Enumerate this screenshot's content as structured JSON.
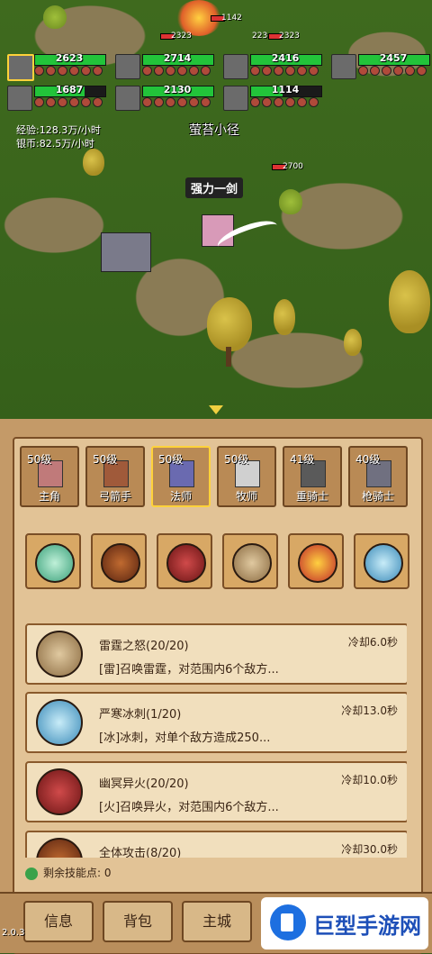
{
  "party": [
    {
      "hp": "2623",
      "selected": true
    },
    {
      "hp": "2714",
      "selected": false
    },
    {
      "hp": "2416",
      "selected": false
    },
    {
      "hp": "2457",
      "selected": false
    },
    {
      "hp": "1687",
      "selected": false
    },
    {
      "hp": "2130",
      "selected": false
    },
    {
      "hp": "1114",
      "selected": false
    }
  ],
  "rates": {
    "exp": "经验:128.3万/小时",
    "silver": "银币:82.5万/小时"
  },
  "location": "萤苔小径",
  "skill_shout": "强力一剑",
  "damage_numbers": [
    "1142",
    "2323",
    "223",
    "2323",
    "2700"
  ],
  "hero_tabs": [
    {
      "level": "50级",
      "name": "主角"
    },
    {
      "level": "50级",
      "name": "弓箭手"
    },
    {
      "level": "50级",
      "name": "法师"
    },
    {
      "level": "50级",
      "name": "牧师"
    },
    {
      "level": "41级",
      "name": "重骑士"
    },
    {
      "level": "40级",
      "name": "枪骑士"
    }
  ],
  "skill_icons": [
    "wind-orb-icon",
    "beast-orb-icon",
    "fire-orb-icon",
    "thunder-orb-icon",
    "flame-orb-icon",
    "ice-orb-icon"
  ],
  "skills": [
    {
      "title": "雷霆之怒(20/20)",
      "cooldown": "冷却6.0秒",
      "desc": "[雷]召唤雷霆，对范围内6个敌方..."
    },
    {
      "title": "严寒冰刺(1/20)",
      "cooldown": "冷却13.0秒",
      "desc": "[冰]冰刺，对单个敌方造成250..."
    },
    {
      "title": "幽冥异火(20/20)",
      "cooldown": "冷却10.0秒",
      "desc": "[火]召唤异火，对范围内6个敌方..."
    },
    {
      "title": "全体攻击(8/20)",
      "cooldown": "冷却30.0秒",
      "desc": ""
    }
  ],
  "skill_points": "剩余技能点:  0",
  "bottom_nav": [
    "信息",
    "背包",
    "主城"
  ],
  "version": "2.0.3",
  "watermark": "巨型手游网",
  "colors": {
    "hp": "#22c43a",
    "panel": "#e2c396",
    "selected": "#ffd23a"
  }
}
